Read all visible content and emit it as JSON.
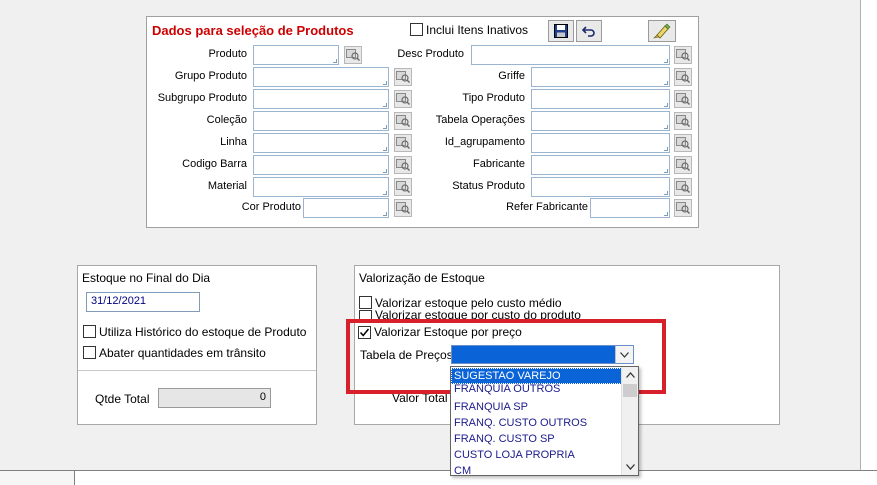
{
  "product_selection": {
    "title": "Dados para seleção de Produtos",
    "include_inactive_label": "Inclui Itens Inativos",
    "fields_left": [
      {
        "label": "Produto",
        "value": ""
      },
      {
        "label": "Grupo Produto",
        "value": ""
      },
      {
        "label": "Subgrupo Produto",
        "value": ""
      },
      {
        "label": "Coleção",
        "value": ""
      },
      {
        "label": "Linha",
        "value": ""
      },
      {
        "label": "Codigo Barra",
        "value": ""
      },
      {
        "label": "Material",
        "value": ""
      },
      {
        "label": "Cor Produto",
        "value": ""
      }
    ],
    "fields_right": [
      {
        "label": "Desc Produto",
        "value": ""
      },
      {
        "label": "Griffe",
        "value": ""
      },
      {
        "label": "Tipo Produto",
        "value": ""
      },
      {
        "label": "Tabela Operações",
        "value": ""
      },
      {
        "label": "Id_agrupamento",
        "value": ""
      },
      {
        "label": "Fabricante",
        "value": ""
      },
      {
        "label": "Status Produto",
        "value": ""
      },
      {
        "label": "Refer Fabricante",
        "value": ""
      }
    ],
    "icons": [
      "save-icon",
      "undo-icon",
      "clear-filter-icon"
    ]
  },
  "end_of_day_stock": {
    "title": "Estoque no Final do Dia",
    "date": "31/12/2021",
    "use_history_label": "Utiliza Histórico do estoque de Produto",
    "use_history_checked": false,
    "subtract_transit_label": "Abater quantidades em trânsito",
    "subtract_transit_checked": false,
    "total_qty_label": "Qtde Total",
    "total_qty_value": "0"
  },
  "stock_valuation": {
    "title": "Valorização de Estoque",
    "avg_cost_label": "Valorizar estoque pelo custo médio",
    "avg_cost_checked": false,
    "product_cost_label": "Valorizar estoque por custo do produto",
    "product_cost_checked": false,
    "by_price_label": "Valorizar Estoque por preço",
    "by_price_checked": true,
    "price_table_label": "Tabela de Preços",
    "price_table_value": "",
    "total_value_label": "Valor Total",
    "dropdown_options": [
      "SUGESTAO VAREJO",
      "FRANQUIA OUTROS",
      "FRANQUIA SP",
      "FRANQ. CUSTO OUTROS",
      "FRANQ. CUSTO SP",
      "CUSTO LOJA PROPRIA",
      "CM"
    ],
    "dropdown_selected_index": 0
  },
  "colors": {
    "title_red": "#cc0000",
    "highlight_red": "#d8202a",
    "selection_blue": "#0a64d8",
    "option_text": "#1b1b8c"
  }
}
